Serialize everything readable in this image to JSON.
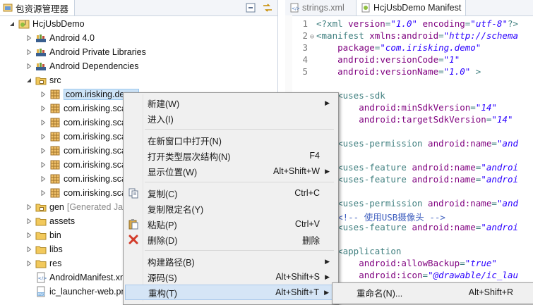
{
  "explorer": {
    "tab_title": "包资源管理器",
    "tree": [
      {
        "label": "HcjUsbDemo",
        "icon": "android-project-icon",
        "twisty": "expanded"
      },
      {
        "label": "Android 4.0",
        "icon": "library-icon",
        "twisty": "collapsed"
      },
      {
        "label": "Android Private Libraries",
        "icon": "library-icon",
        "twisty": "collapsed"
      },
      {
        "label": "Android Dependencies",
        "icon": "library-icon",
        "twisty": "collapsed"
      },
      {
        "label": "src",
        "icon": "source-folder-icon",
        "twisty": "expanded"
      },
      {
        "label": "com.irisking.demo",
        "icon": "package-icon",
        "twisty": "collapsed",
        "selected": true
      },
      {
        "label": "com.irisking.sca",
        "icon": "package-icon",
        "twisty": "collapsed"
      },
      {
        "label": "com.irisking.sca",
        "icon": "package-icon",
        "twisty": "collapsed"
      },
      {
        "label": "com.irisking.sca",
        "icon": "package-icon",
        "twisty": "collapsed"
      },
      {
        "label": "com.irisking.sca",
        "icon": "package-icon",
        "twisty": "collapsed"
      },
      {
        "label": "com.irisking.sca",
        "icon": "package-icon",
        "twisty": "collapsed"
      },
      {
        "label": "com.irisking.sca",
        "icon": "package-icon",
        "twisty": "collapsed"
      },
      {
        "label": "com.irisking.sca",
        "icon": "package-icon",
        "twisty": "collapsed"
      },
      {
        "label": "gen",
        "note": "[Generated Jav",
        "icon": "source-folder-icon",
        "twisty": "collapsed"
      },
      {
        "label": "assets",
        "icon": "folder-icon",
        "twisty": "collapsed"
      },
      {
        "label": "bin",
        "icon": "folder-icon",
        "twisty": "collapsed"
      },
      {
        "label": "libs",
        "icon": "folder-icon",
        "twisty": "collapsed"
      },
      {
        "label": "res",
        "icon": "folder-icon",
        "twisty": "collapsed"
      },
      {
        "label": "AndroidManifest.xml",
        "icon": "xml-file-icon",
        "twisty": "none"
      },
      {
        "label": "ic_launcher-web.png",
        "icon": "png-file-icon",
        "twisty": "none"
      }
    ]
  },
  "editor": {
    "tabs": [
      {
        "label": "strings.xml",
        "icon": "xml-file-icon",
        "active": false
      },
      {
        "label": "HcjUsbDemo Manifest",
        "icon": "android-manifest-icon",
        "active": true
      }
    ],
    "lines": [
      {
        "num": "1",
        "fold": "",
        "tokens": [
          [
            "tag",
            "<?xml "
          ],
          [
            "attr",
            "version"
          ],
          [
            "tag",
            "="
          ],
          [
            "str",
            "\"1.0\""
          ],
          [
            "tag",
            " "
          ],
          [
            "attr",
            "encoding"
          ],
          [
            "tag",
            "="
          ],
          [
            "str",
            "\"utf-8\""
          ],
          [
            "tag",
            "?>"
          ]
        ]
      },
      {
        "num": "2",
        "fold": "⊖",
        "tokens": [
          [
            "tag",
            "<manifest "
          ],
          [
            "attr",
            "xmlns:android"
          ],
          [
            "tag",
            "="
          ],
          [
            "str",
            "\"http://schema"
          ]
        ]
      },
      {
        "num": "3",
        "fold": "",
        "tokens": [
          [
            "tag",
            "    "
          ],
          [
            "attr",
            "package"
          ],
          [
            "tag",
            "="
          ],
          [
            "str",
            "\"com.irisking.demo\""
          ]
        ]
      },
      {
        "num": "4",
        "fold": "",
        "tokens": [
          [
            "tag",
            "    "
          ],
          [
            "attr",
            "android:versionCode"
          ],
          [
            "tag",
            "="
          ],
          [
            "str",
            "\"1\""
          ]
        ]
      },
      {
        "num": "5",
        "fold": "",
        "tokens": [
          [
            "tag",
            "    "
          ],
          [
            "attr",
            "android:versionName"
          ],
          [
            "tag",
            "="
          ],
          [
            "str",
            "\"1.0\""
          ],
          [
            "tag",
            " >"
          ]
        ]
      },
      {
        "num": "",
        "fold": "",
        "tokens": []
      },
      {
        "num": "7",
        "fold": "",
        "tokens": [
          [
            "tag",
            "    <uses-sdk"
          ]
        ]
      },
      {
        "num": "",
        "fold": "",
        "tokens": [
          [
            "tag",
            "        "
          ],
          [
            "attr",
            "android:minSdkVersion"
          ],
          [
            "tag",
            "="
          ],
          [
            "str",
            "\"14\""
          ]
        ]
      },
      {
        "num": "",
        "fold": "",
        "tokens": [
          [
            "tag",
            "        "
          ],
          [
            "attr",
            "android:targetSdkVersion"
          ],
          [
            "tag",
            "="
          ],
          [
            "str",
            "\"14\""
          ]
        ]
      },
      {
        "num": "",
        "fold": "",
        "tokens": []
      },
      {
        "num": "",
        "fold": "",
        "tokens": [
          [
            "tag",
            "    <uses-permission "
          ],
          [
            "attr",
            "android:name"
          ],
          [
            "tag",
            "="
          ],
          [
            "str",
            "\"and"
          ]
        ]
      },
      {
        "num": "",
        "fold": "",
        "tokens": []
      },
      {
        "num": "",
        "fold": "",
        "tokens": [
          [
            "tag",
            "    <uses-feature "
          ],
          [
            "attr",
            "android:name"
          ],
          [
            "tag",
            "="
          ],
          [
            "str",
            "\"androi"
          ]
        ]
      },
      {
        "num": "",
        "fold": "",
        "tokens": [
          [
            "tag",
            "    <uses-feature "
          ],
          [
            "attr",
            "android:name"
          ],
          [
            "tag",
            "="
          ],
          [
            "str",
            "\"androi"
          ]
        ]
      },
      {
        "num": "",
        "fold": "",
        "tokens": []
      },
      {
        "num": "",
        "fold": "",
        "tokens": [
          [
            "tag",
            "    <uses-permission "
          ],
          [
            "attr",
            "android:name"
          ],
          [
            "tag",
            "="
          ],
          [
            "str",
            "\"and"
          ]
        ]
      },
      {
        "num": "",
        "fold": "",
        "tokens": [
          [
            "cmt",
            "    <!-- 使用USB摄像头 -->"
          ]
        ]
      },
      {
        "num": "",
        "fold": "",
        "tokens": [
          [
            "tag",
            "    <uses-feature "
          ],
          [
            "attr",
            "android:name"
          ],
          [
            "tag",
            "="
          ],
          [
            "str",
            "\"androi"
          ]
        ]
      },
      {
        "num": "",
        "fold": "",
        "tokens": []
      },
      {
        "num": "",
        "fold": "",
        "tokens": [
          [
            "tag",
            "    <application"
          ]
        ]
      },
      {
        "num": "",
        "fold": "",
        "tokens": [
          [
            "tag",
            "        "
          ],
          [
            "attr",
            "android:allowBackup"
          ],
          [
            "tag",
            "="
          ],
          [
            "str",
            "\"true\""
          ]
        ]
      },
      {
        "num": "",
        "fold": "",
        "tokens": [
          [
            "tag",
            "        "
          ],
          [
            "attr",
            "android:icon"
          ],
          [
            "tag",
            "="
          ],
          [
            "str",
            "\"@drawable/ic_lau"
          ]
        ]
      }
    ]
  },
  "context_menu": {
    "items": [
      {
        "kind": "item",
        "label": "新建(W)",
        "shortcut": "",
        "submenu": true,
        "icon": ""
      },
      {
        "kind": "item",
        "label": "进入(I)",
        "shortcut": "",
        "submenu": false,
        "icon": ""
      },
      {
        "kind": "sep"
      },
      {
        "kind": "item",
        "label": "在新窗口中打开(N)",
        "shortcut": "",
        "submenu": false,
        "icon": ""
      },
      {
        "kind": "item",
        "label": "打开类型层次结构(N)",
        "shortcut": "F4",
        "submenu": false,
        "icon": ""
      },
      {
        "kind": "item",
        "label": "显示位置(W)",
        "shortcut": "Alt+Shift+W",
        "submenu": true,
        "icon": ""
      },
      {
        "kind": "sep"
      },
      {
        "kind": "item",
        "label": "复制(C)",
        "shortcut": "Ctrl+C",
        "submenu": false,
        "icon": "copy-icon"
      },
      {
        "kind": "item",
        "label": "复制限定名(Y)",
        "shortcut": "",
        "submenu": false,
        "icon": ""
      },
      {
        "kind": "item",
        "label": "粘贴(P)",
        "shortcut": "Ctrl+V",
        "submenu": false,
        "icon": "paste-icon"
      },
      {
        "kind": "item",
        "label": "删除(D)",
        "shortcut": "删除",
        "submenu": false,
        "icon": "delete-icon"
      },
      {
        "kind": "sep"
      },
      {
        "kind": "item",
        "label": "构建路径(B)",
        "shortcut": "",
        "submenu": true,
        "icon": ""
      },
      {
        "kind": "item",
        "label": "源码(S)",
        "shortcut": "Alt+Shift+S",
        "submenu": true,
        "icon": ""
      },
      {
        "kind": "item",
        "label": "重构(T)",
        "shortcut": "Alt+Shift+T",
        "submenu": true,
        "icon": "",
        "hover": true
      }
    ]
  },
  "submenu": {
    "items": [
      {
        "label": "重命名(N)...",
        "shortcut": "Alt+Shift+R"
      }
    ]
  }
}
